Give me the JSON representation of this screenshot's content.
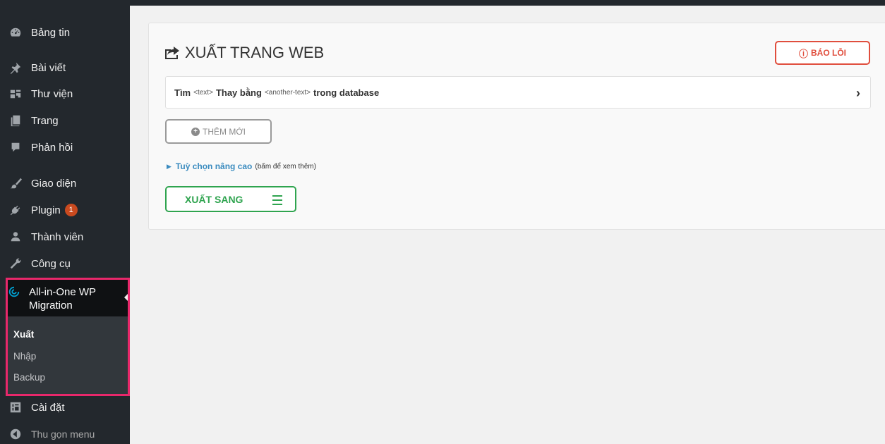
{
  "sidebar": {
    "items": [
      {
        "label": "Bảng tin",
        "icon": "dashboard-icon"
      },
      {
        "label": "Bài viết",
        "icon": "pin-icon"
      },
      {
        "label": "Thư viện",
        "icon": "media-icon"
      },
      {
        "label": "Trang",
        "icon": "page-icon"
      },
      {
        "label": "Phản hồi",
        "icon": "comment-icon"
      },
      {
        "label": "Giao diện",
        "icon": "brush-icon"
      },
      {
        "label": "Plugin",
        "icon": "plugin-icon",
        "badge": "1"
      },
      {
        "label": "Thành viên",
        "icon": "users-icon"
      },
      {
        "label": "Công cụ",
        "icon": "wrench-icon"
      }
    ],
    "active": {
      "label_line1": "All-in-One WP",
      "label_line2": "Migration",
      "icon": "migration-icon"
    },
    "submenu": [
      "Xuất",
      "Nhập",
      "Backup"
    ],
    "settings": {
      "label": "Cài đặt",
      "icon": "settings-icon"
    },
    "collapse": {
      "label": "Thu gọn menu",
      "icon": "collapse-icon"
    }
  },
  "main": {
    "title": "XUẤT TRANG WEB",
    "report_button": "BÁO LỖI",
    "find_replace": {
      "find_label": "Tìm",
      "find_placeholder": "<text>",
      "replace_label": "Thay bằng",
      "replace_placeholder": "<another-text>",
      "suffix": "trong database"
    },
    "add_button": "THÊM MỚI",
    "advanced": {
      "link": "Tuỳ chọn nâng cao",
      "hint": "(bấm để xem thêm)"
    },
    "export_button": "XUẤT SANG"
  },
  "colors": {
    "sidebar_bg": "#23282d",
    "highlight_border": "#e8286b",
    "report_red": "#e04e3d",
    "export_green": "#2fa44f",
    "link_blue": "#3a8bbf",
    "badge_orange": "#ca4a1f"
  }
}
